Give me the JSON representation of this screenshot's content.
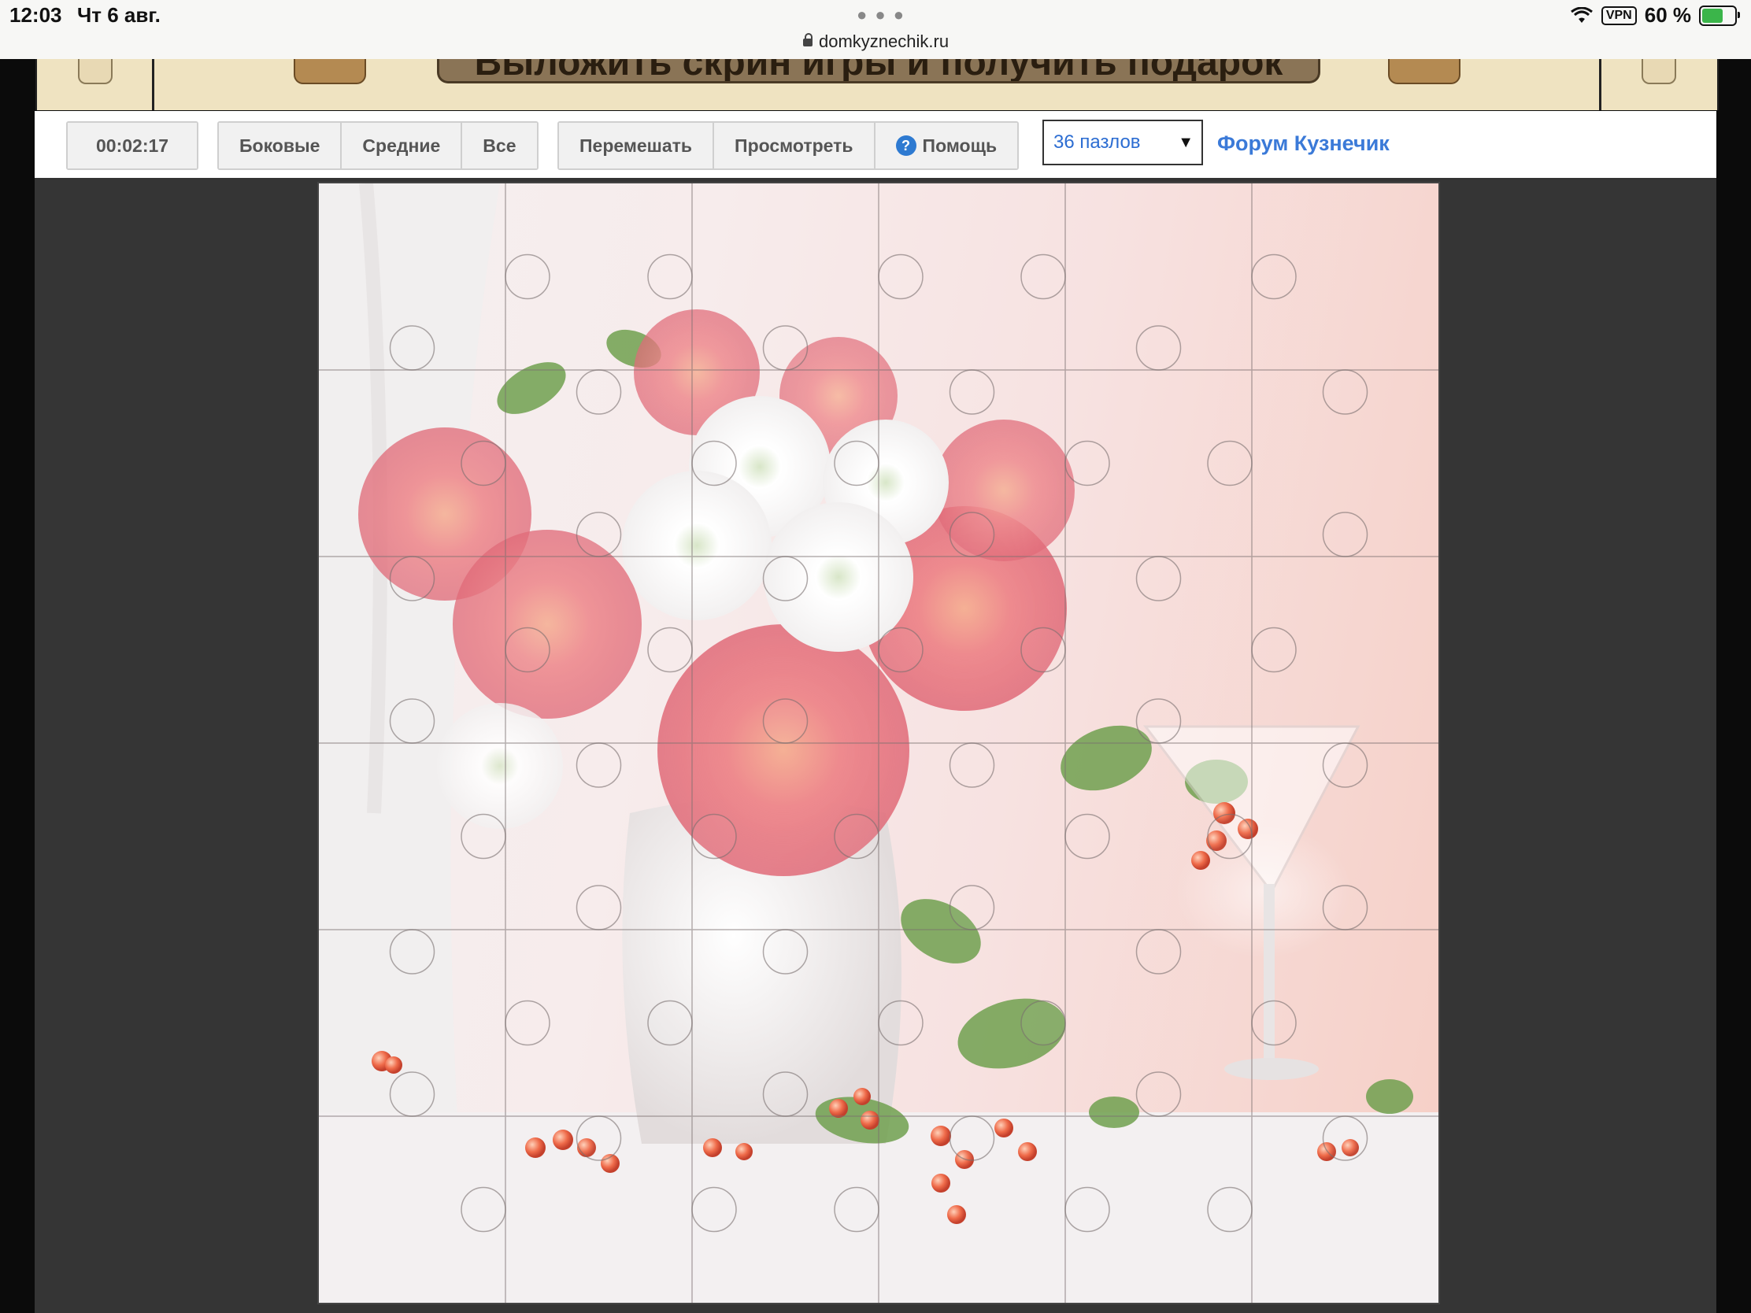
{
  "status_bar": {
    "time": "12:03",
    "date": "Чт 6 авг.",
    "url": "domkyznechik.ru",
    "vpn": "VPN",
    "battery": "60 %"
  },
  "banner": {
    "cta": "Выложить скрин игры и получить подарок"
  },
  "toolbar": {
    "timer": "00:02:17",
    "filter_side": "Боковые",
    "filter_middle": "Средние",
    "filter_all": "Все",
    "shuffle": "Перемешать",
    "preview": "Просмотреть",
    "help": "Помощь",
    "pieces_select": "36 пазлов",
    "forum_link": "Форум Кузнечик"
  },
  "puzzle": {
    "pieces": 36,
    "grid": 6
  },
  "colors": {
    "link": "#3b7ad8",
    "stage_bg": "#353535",
    "banner_bg": "#efe3c1"
  }
}
